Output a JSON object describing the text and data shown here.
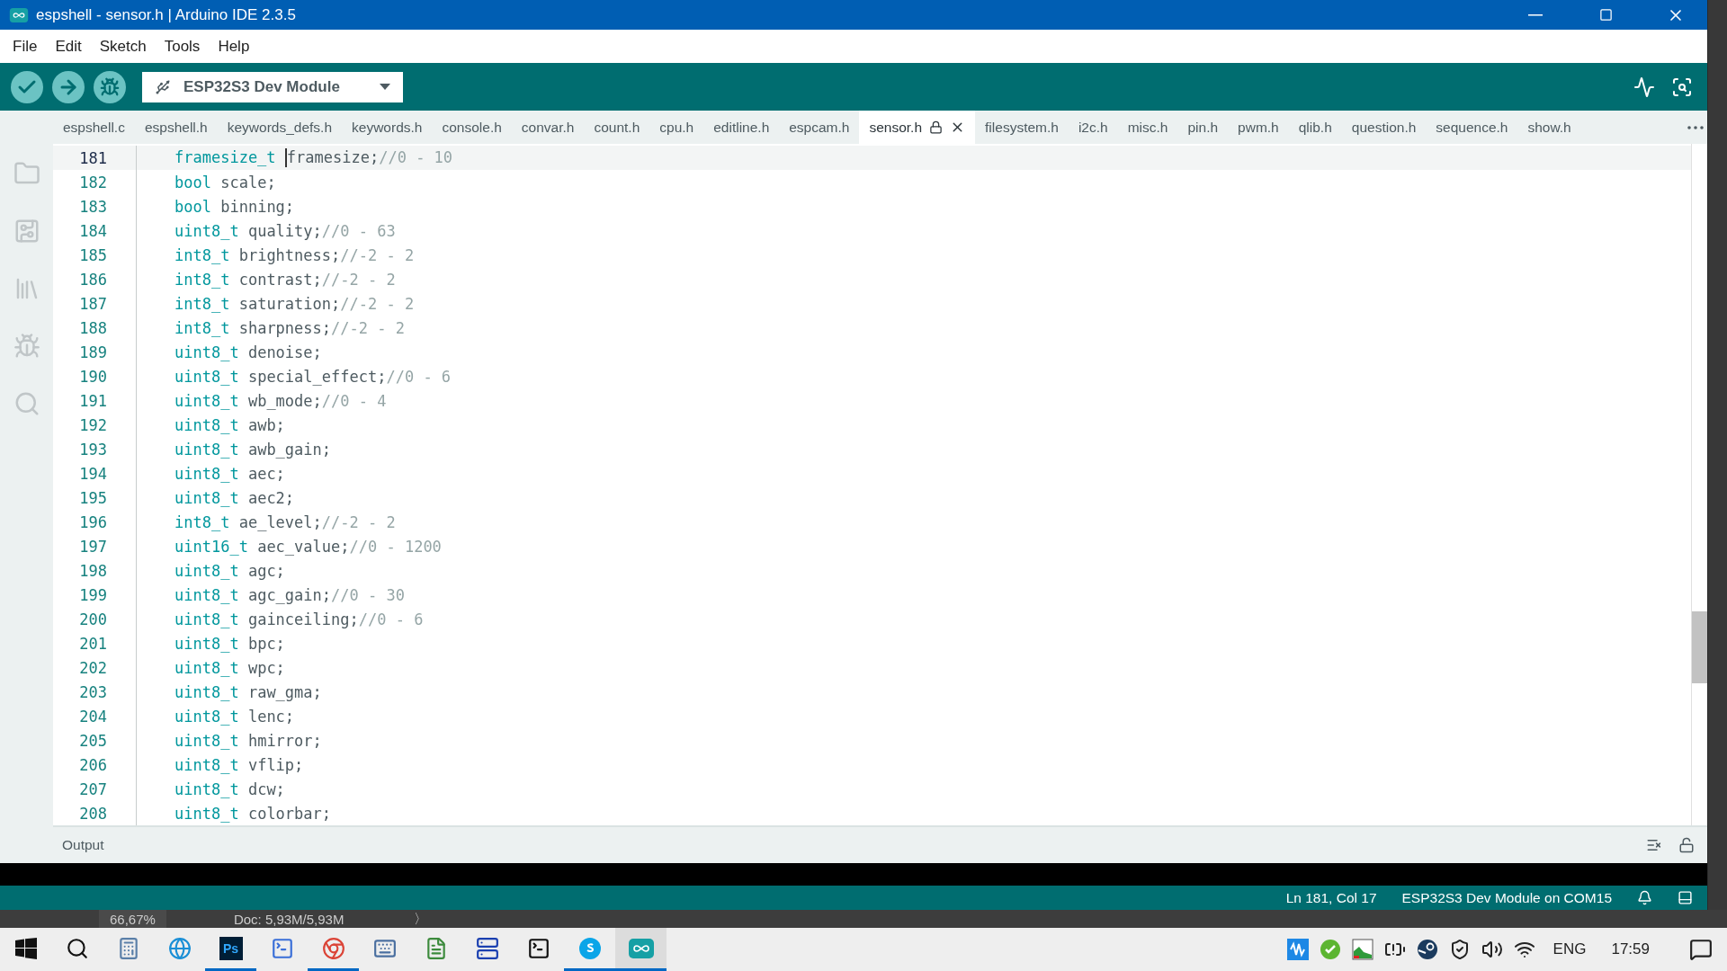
{
  "window": {
    "title": "espshell - sensor.h | Arduino IDE 2.3.5"
  },
  "menu": [
    "File",
    "Edit",
    "Sketch",
    "Tools",
    "Help"
  ],
  "board_selector": {
    "label": "ESP32S3 Dev Module"
  },
  "tabs": [
    {
      "label": "espshell.c",
      "selected": false
    },
    {
      "label": "espshell.h",
      "selected": false
    },
    {
      "label": "keywords_defs.h",
      "selected": false
    },
    {
      "label": "keywords.h",
      "selected": false
    },
    {
      "label": "console.h",
      "selected": false
    },
    {
      "label": "convar.h",
      "selected": false
    },
    {
      "label": "count.h",
      "selected": false
    },
    {
      "label": "cpu.h",
      "selected": false
    },
    {
      "label": "editline.h",
      "selected": false
    },
    {
      "label": "espcam.h",
      "selected": false
    },
    {
      "label": "sensor.h",
      "selected": true
    },
    {
      "label": "filesystem.h",
      "selected": false
    },
    {
      "label": "i2c.h",
      "selected": false
    },
    {
      "label": "misc.h",
      "selected": false
    },
    {
      "label": "pin.h",
      "selected": false
    },
    {
      "label": "pwm.h",
      "selected": false
    },
    {
      "label": "qlib.h",
      "selected": false
    },
    {
      "label": "question.h",
      "selected": false
    },
    {
      "label": "sequence.h",
      "selected": false
    },
    {
      "label": "show.h",
      "selected": false
    }
  ],
  "code_lines": [
    {
      "number": "181",
      "type": "framesize_t",
      "name": "framesize;",
      "comment": "//0 - 10",
      "current": true
    },
    {
      "number": "182",
      "type": "bool",
      "name": "scale;",
      "current": false
    },
    {
      "number": "183",
      "type": "bool",
      "name": "binning;",
      "current": false
    },
    {
      "number": "184",
      "type": "uint8_t",
      "name": "quality;",
      "comment": "//0 - 63",
      "current": false
    },
    {
      "number": "185",
      "type": "int8_t",
      "name": "brightness;",
      "comment": "//-2 - 2",
      "current": false
    },
    {
      "number": "186",
      "type": "int8_t",
      "name": "contrast;",
      "comment": "//-2 - 2",
      "current": false
    },
    {
      "number": "187",
      "type": "int8_t",
      "name": "saturation;",
      "comment": "//-2 - 2",
      "current": false
    },
    {
      "number": "188",
      "type": "int8_t",
      "name": "sharpness;",
      "comment": "//-2 - 2",
      "current": false
    },
    {
      "number": "189",
      "type": "uint8_t",
      "name": "denoise;",
      "current": false
    },
    {
      "number": "190",
      "type": "uint8_t",
      "name": "special_effect;",
      "comment": "//0 - 6",
      "current": false
    },
    {
      "number": "191",
      "type": "uint8_t",
      "name": "wb_mode;",
      "comment": "//0 - 4",
      "current": false
    },
    {
      "number": "192",
      "type": "uint8_t",
      "name": "awb;",
      "current": false
    },
    {
      "number": "193",
      "type": "uint8_t",
      "name": "awb_gain;",
      "current": false
    },
    {
      "number": "194",
      "type": "uint8_t",
      "name": "aec;",
      "current": false
    },
    {
      "number": "195",
      "type": "uint8_t",
      "name": "aec2;",
      "current": false
    },
    {
      "number": "196",
      "type": "int8_t",
      "name": "ae_level;",
      "comment": "//-2 - 2",
      "current": false
    },
    {
      "number": "197",
      "type": "uint16_t",
      "name": "aec_value;",
      "comment": "//0 - 1200",
      "current": false
    },
    {
      "number": "198",
      "type": "uint8_t",
      "name": "agc;",
      "current": false
    },
    {
      "number": "199",
      "type": "uint8_t",
      "name": "agc_gain;",
      "comment": "//0 - 30",
      "current": false
    },
    {
      "number": "200",
      "type": "uint8_t",
      "name": "gainceiling;",
      "comment": "//0 - 6",
      "current": false
    },
    {
      "number": "201",
      "type": "uint8_t",
      "name": "bpc;",
      "current": false
    },
    {
      "number": "202",
      "type": "uint8_t",
      "name": "wpc;",
      "current": false
    },
    {
      "number": "203",
      "type": "uint8_t",
      "name": "raw_gma;",
      "current": false
    },
    {
      "number": "204",
      "type": "uint8_t",
      "name": "lenc;",
      "current": false
    },
    {
      "number": "205",
      "type": "uint8_t",
      "name": "hmirror;",
      "current": false
    },
    {
      "number": "206",
      "type": "uint8_t",
      "name": "vflip;",
      "current": false
    },
    {
      "number": "207",
      "type": "uint8_t",
      "name": "dcw;",
      "current": false
    },
    {
      "number": "208",
      "type": "uint8_t",
      "name": "colorbar;",
      "current": false
    }
  ],
  "output_panel": {
    "title": "Output"
  },
  "status_bar": {
    "position": "Ln 181, Col 17",
    "board": "ESP32S3 Dev Module on COM15"
  },
  "background_app": {
    "zoom": "66,67%",
    "doc": "Doc: 5,93M/5,93M",
    "arrow": "〉"
  },
  "taskbar": {
    "apps": [
      {
        "kind": "calculator",
        "running": false,
        "selected": false
      },
      {
        "kind": "edge",
        "running": false,
        "selected": false
      },
      {
        "kind": "photoshop",
        "label": "Ps",
        "running": true,
        "selected": false
      },
      {
        "kind": "powershell",
        "running": false,
        "selected": false
      },
      {
        "kind": "chrome",
        "running": true,
        "selected": false
      },
      {
        "kind": "keyboard",
        "running": false,
        "selected": false
      },
      {
        "kind": "notepad",
        "running": false,
        "selected": false
      },
      {
        "kind": "server",
        "running": false,
        "selected": false
      },
      {
        "kind": "terminal",
        "running": false,
        "selected": false
      },
      {
        "kind": "skype",
        "running": true,
        "selected": false
      },
      {
        "kind": "arduino",
        "running": true,
        "selected": true
      }
    ],
    "language": "ENG",
    "time": "17:59"
  }
}
